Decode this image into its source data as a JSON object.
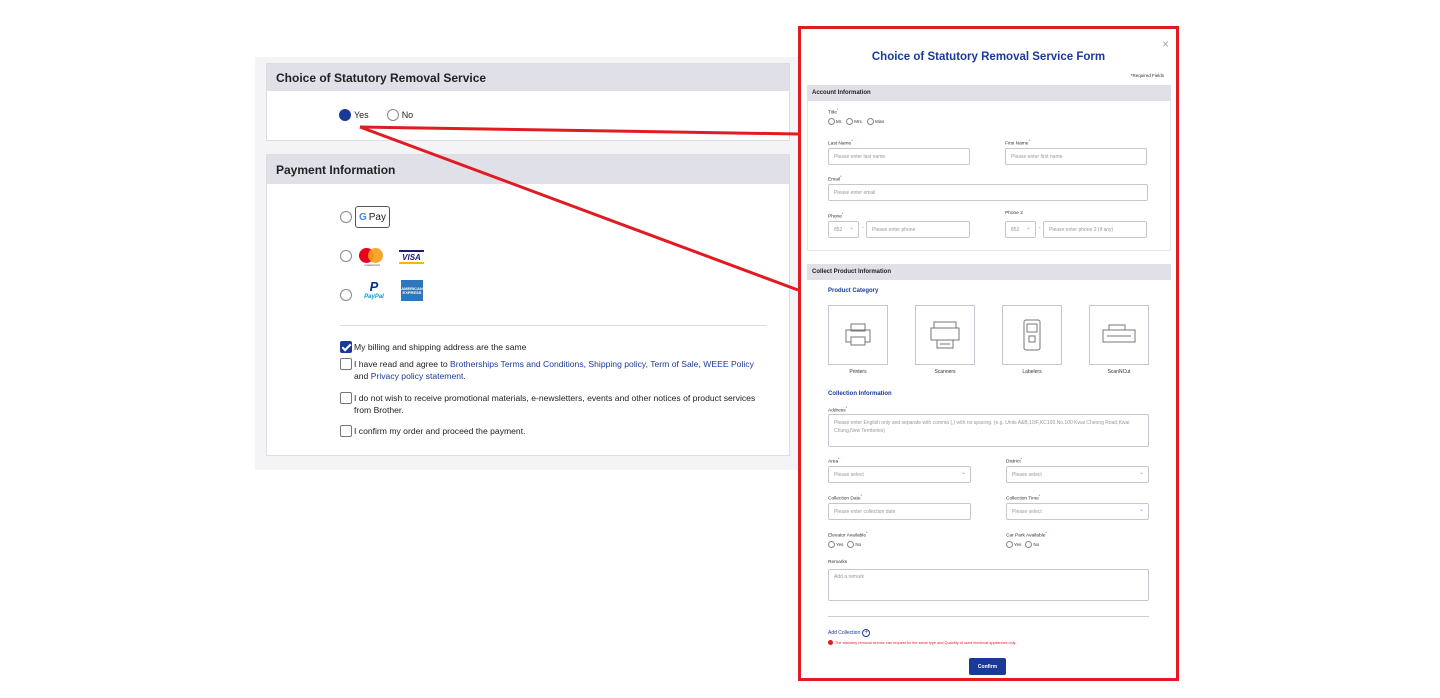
{
  "statutory": {
    "heading": "Choice of Statutory Removal Service",
    "options": [
      "Yes",
      "No"
    ],
    "selected": "Yes"
  },
  "payment": {
    "heading": "Payment Information",
    "gpay_label": "Pay",
    "gpay_g": "G",
    "mastercard_label": "mastercard",
    "visa_label": "VISA",
    "paypal_p": "P",
    "paypal_label": "PayPal",
    "amex_label": "AMERICAN EXPRESS",
    "billing_same": "My billing and shipping address are the same",
    "terms_prefix": "I have read and agree to",
    "terms_link1": "Brotherships Terms and Conditions",
    "terms_sep1": ",",
    "terms_link2": "Shipping policy,",
    "terms_link3": "Term of Sale",
    "terms_sep2": ",",
    "terms_link4": "WEEE Policy",
    "terms_and": "and",
    "terms_link5": "Privacy policy statement",
    "terms_end": ".",
    "promo": "I do not wish to receive promotional materials, e-newsletters, events and other notices of product services from Brother.",
    "confirm_order": "I confirm my order and proceed the payment."
  },
  "modal": {
    "title": "Choice of Statutory Removal Service Form",
    "close": "×",
    "required_fields": "*Required Fields",
    "account_heading": "Account Information",
    "title_label": "Title",
    "title_options": [
      "Mr.",
      "Mrs.",
      "Miss"
    ],
    "last_name_label": "Last Name",
    "last_name_ph": "Please enter last name",
    "first_name_label": "First Name",
    "first_name_ph": "Please enter first name",
    "email_label": "Email",
    "email_ph": "Please enter email",
    "phone_label": "Phone",
    "phone_code": "852",
    "phone_ph": "Please enter phone",
    "phone2_label": "Phone 2",
    "phone2_code": "852",
    "phone2_ph": "Please enter phone 2 (if any)",
    "collect_heading": "Collect Product Information",
    "product_category": "Product Category",
    "categories": [
      "Printers",
      "Scanners",
      "Labelers",
      "ScanNCut"
    ],
    "collection_info": "Collection Information",
    "address_label": "Address",
    "address_ph": "Please enter English only and separate with comma (,) with no spacing. (e.g. Units A&B,10/F,KC100,No.100 Kwai Cheong Road,Kwai Chung,New Territories)",
    "area_label": "Area",
    "area_ph": "Please select",
    "district_label": "District",
    "district_ph": "Please select",
    "date_label": "Collection Date",
    "date_ph": "Please enter collection date",
    "time_label": "Collection Time",
    "time_ph": "Please select",
    "elevator_label": "Elevator Available",
    "carpark_label": "Car Park Available",
    "yes": "Yes",
    "no": "No",
    "remarks_label": "Remarks",
    "remarks_ph": "Add a remark",
    "add_collection": "Add Collection",
    "warning": "The statutory removal service can request for the same type and Quantity of used electrical appliances only.",
    "confirm": "Confirm"
  },
  "colors": {
    "accent": "#1a3a9a",
    "highlight": "#e11b22",
    "section_bg": "#dfe0e8"
  }
}
